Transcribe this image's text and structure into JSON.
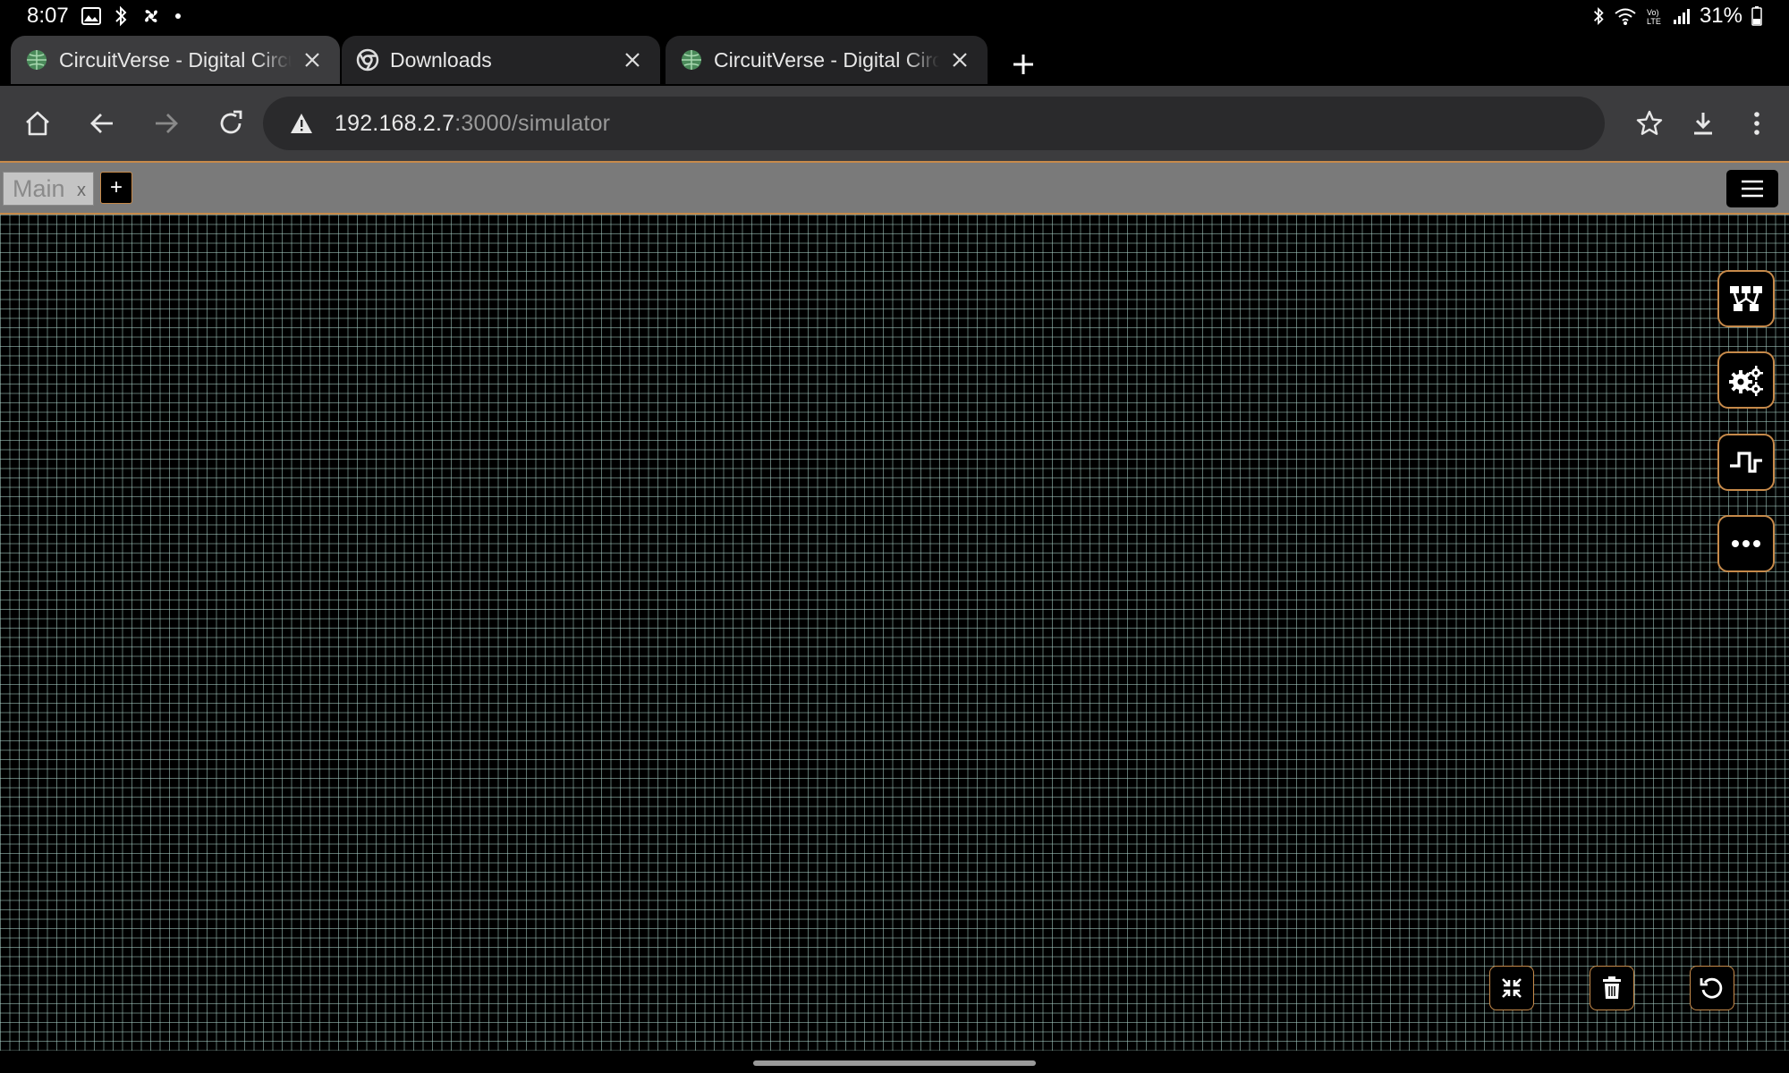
{
  "status_bar": {
    "time": "8:07",
    "battery": "31%",
    "left_icons": [
      "image-icon",
      "bluetooth-icon",
      "fan-icon",
      "dot-icon"
    ],
    "right_icons": [
      "bluetooth-icon",
      "wifi-icon",
      "volte-icon",
      "signal-icon",
      "battery-icon"
    ]
  },
  "browser": {
    "tabs": [
      {
        "title": "CircuitVerse - Digital Circuit Simulator",
        "icon": "globe-icon",
        "active": true
      },
      {
        "title": "Downloads",
        "icon": "chrome-icon",
        "active": false
      },
      {
        "title": "CircuitVerse - Digital Circuit Simulator",
        "icon": "globe-icon",
        "active": false
      }
    ],
    "url_host": "192.168.2.7",
    "url_rest": ":3000/simulator"
  },
  "simulator": {
    "circuit_tabs": [
      {
        "name": "Main",
        "close": "x"
      }
    ],
    "add_label": "+",
    "side_buttons": [
      "circuit-elements-icon",
      "settings-icon",
      "timing-diagram-icon",
      "more-icon"
    ],
    "bottom_buttons": [
      "fit-screen-icon",
      "delete-icon",
      "undo-icon"
    ]
  },
  "colors": {
    "accent": "#c78a4a",
    "grid": "#aad2c8",
    "toolbar": "#3c3c3e"
  }
}
